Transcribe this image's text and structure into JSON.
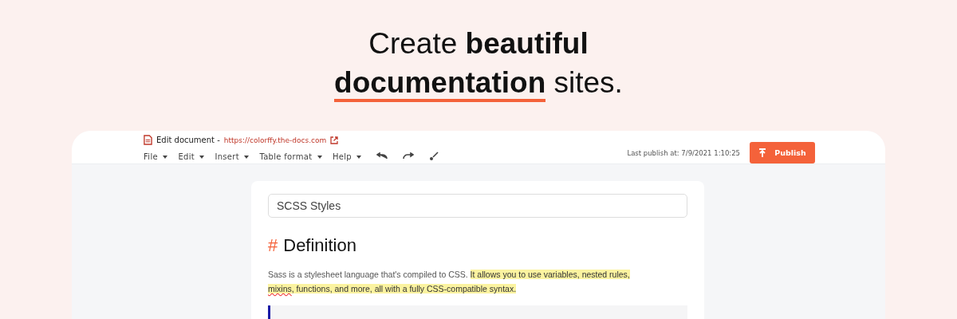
{
  "headline": {
    "lines": [
      [
        {
          "text": "Create",
          "bold": false,
          "underlined": false
        },
        {
          "text": "beautiful",
          "bold": true,
          "underlined": false
        }
      ],
      [
        {
          "text": "documentation",
          "bold": true,
          "underlined": true
        },
        {
          "text": "sites.",
          "bold": false,
          "underlined": false
        }
      ]
    ]
  },
  "editor": {
    "title": "Edit document -",
    "url": "https://colorffy.the-docs.com",
    "menus": [
      {
        "label": "File"
      },
      {
        "label": "Edit"
      },
      {
        "label": "Insert"
      },
      {
        "label": "Table format"
      },
      {
        "label": "Help"
      }
    ],
    "tools": [
      {
        "kind": "undo"
      },
      {
        "kind": "redo"
      },
      {
        "kind": "brush"
      }
    ],
    "last_publish": "Last publish at: 7/9/2021 1:10:25",
    "publish_button": "Publish"
  },
  "document": {
    "title_value": "SCSS Styles",
    "heading_mark": "#",
    "heading": "Definition",
    "paragraph": [
      {
        "text": "Sass is a stylesheet language that's compiled to CSS. ",
        "highlighted": false,
        "misspelled": false
      },
      {
        "text": "It allows you to use variables, nested rules, ",
        "highlighted": true,
        "misspelled": false
      },
      {
        "text": "mixins",
        "highlighted": true,
        "misspelled": true
      },
      {
        "text": ", functions, and more, all with a fully CSS-compatible syntax.",
        "highlighted": true,
        "misspelled": false
      }
    ]
  }
}
